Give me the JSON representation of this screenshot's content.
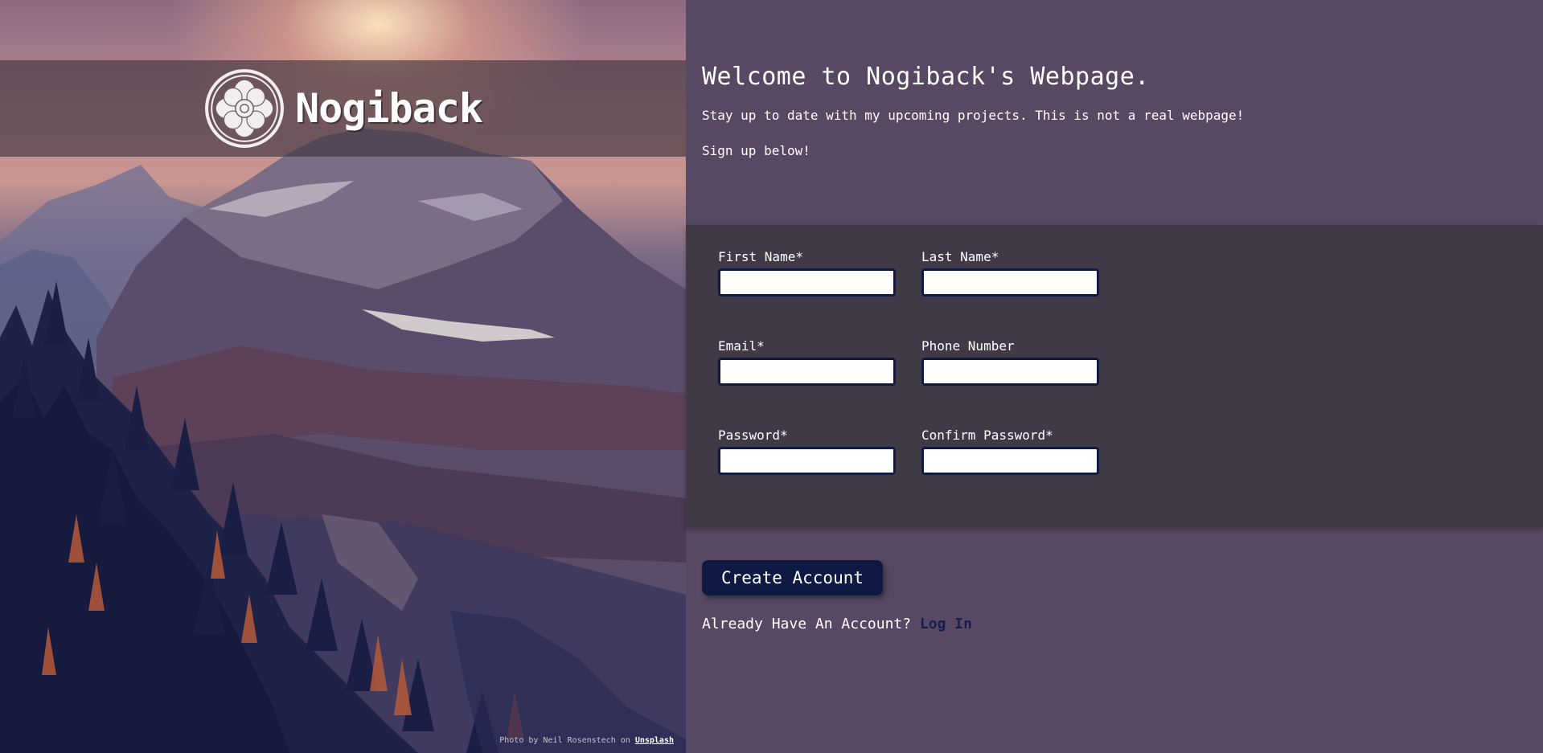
{
  "brand": {
    "name": "Nogiback",
    "logo_icon": "white-lotus-icon"
  },
  "hero": {
    "credit_prefix": "Photo by Neil Rosenstech on",
    "credit_link": "Unsplash"
  },
  "intro": {
    "heading": "Welcome to Nogiback's Webpage.",
    "tagline": "Stay up to date with my upcoming projects. This is not a real webpage!",
    "cta": "Sign up below!"
  },
  "form": {
    "first_name_label": "First Name*",
    "last_name_label": "Last Name*",
    "email_label": "Email*",
    "phone_label": "Phone Number",
    "password_label": "Password*",
    "confirm_password_label": "Confirm Password*",
    "first_name_value": "",
    "last_name_value": "",
    "email_value": "",
    "phone_value": "",
    "password_value": "",
    "confirm_password_value": ""
  },
  "actions": {
    "create_label": "Create Account",
    "login_prompt": "Already Have An Account?",
    "login_link": "Log In"
  },
  "colors": {
    "panel_bg": "#574863",
    "form_bg": "#403a46",
    "button_bg": "#0f1a44",
    "input_border": "#0f1a44",
    "link": "#15204f"
  }
}
